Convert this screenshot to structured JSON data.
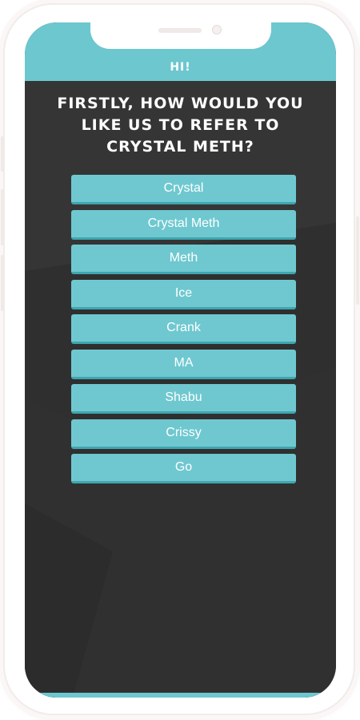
{
  "app": {
    "greeting": "HI!",
    "question": "Firstly, how would you like us to refer to crystal meth?"
  },
  "options": [
    {
      "label": "Crystal"
    },
    {
      "label": "Crystal Meth"
    },
    {
      "label": "Meth"
    },
    {
      "label": "Ice"
    },
    {
      "label": "Crank"
    },
    {
      "label": "MA"
    },
    {
      "label": "Shabu"
    },
    {
      "label": "Crissy"
    },
    {
      "label": "Go"
    }
  ],
  "colors": {
    "accent": "#6cc7cf",
    "button": "#6fc8d0",
    "button_shadow": "#3ea6b0",
    "background": "#323232",
    "text": "#ffffff"
  }
}
